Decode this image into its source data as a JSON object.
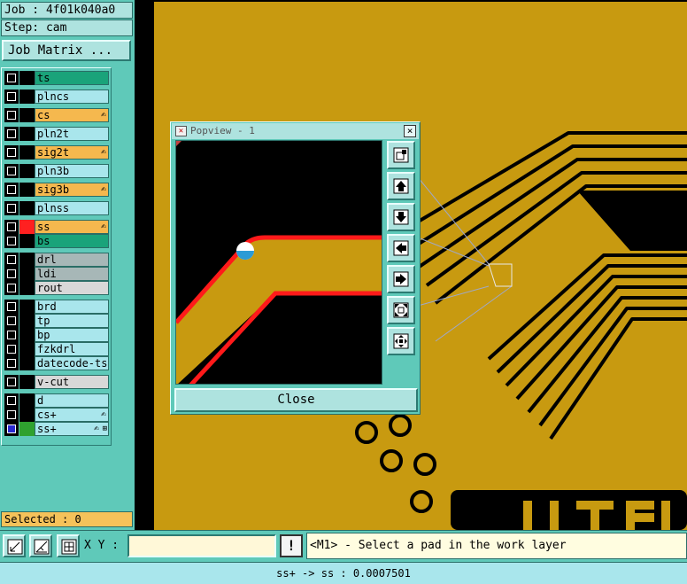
{
  "info": {
    "job": "Job : 4f01k040a0",
    "step": "Step: cam"
  },
  "job_matrix_button": "Job Matrix ...",
  "layers": [
    {
      "name": "ts",
      "color": "#1aa37a",
      "swatch": "#000000",
      "checked": false,
      "flag": ""
    },
    {
      "name": "plncs",
      "color": "#a9e6ec",
      "swatch": "#000000",
      "checked": false,
      "flag": ""
    },
    {
      "name": "cs",
      "color": "#f5b84e",
      "swatch": "#000000",
      "checked": false,
      "flag": "✍"
    },
    {
      "name": "pln2t",
      "color": "#a9e6ec",
      "swatch": "#000000",
      "checked": false,
      "flag": ""
    },
    {
      "name": "sig2t",
      "color": "#f5b84e",
      "swatch": "#000000",
      "checked": false,
      "flag": "✍"
    },
    {
      "name": "pln3b",
      "color": "#a9e6ec",
      "swatch": "#000000",
      "checked": false,
      "flag": ""
    },
    {
      "name": "sig3b",
      "color": "#f5b84e",
      "swatch": "#000000",
      "checked": false,
      "flag": "✍"
    },
    {
      "name": "plnss",
      "color": "#a9e6ec",
      "swatch": "#000000",
      "checked": false,
      "flag": ""
    },
    {
      "name": "ss",
      "color": "#f5b84e",
      "swatch": "#ff2020",
      "checked": false,
      "flag": "✍"
    },
    {
      "name": "bs",
      "color": "#1aa37a",
      "swatch": "#000000",
      "checked": false,
      "flag": ""
    },
    {
      "name": "drl",
      "color": "#a7b7b7",
      "swatch": "#000000",
      "checked": false,
      "flag": ""
    },
    {
      "name": "ldi",
      "color": "#a7b7b7",
      "swatch": "#000000",
      "checked": false,
      "flag": ""
    },
    {
      "name": "rout",
      "color": "#d8d8d8",
      "swatch": "#000000",
      "checked": false,
      "flag": ""
    },
    {
      "name": "brd",
      "color": "#a9e6ec",
      "swatch": "#000000",
      "checked": false,
      "flag": ""
    },
    {
      "name": "tp",
      "color": "#a9e6ec",
      "swatch": "#000000",
      "checked": false,
      "flag": ""
    },
    {
      "name": "bp",
      "color": "#a9e6ec",
      "swatch": "#000000",
      "checked": false,
      "flag": ""
    },
    {
      "name": "fzkdrl",
      "color": "#a9e6ec",
      "swatch": "#000000",
      "checked": false,
      "flag": ""
    },
    {
      "name": "datecode-ts",
      "color": "#a9e6ec",
      "swatch": "#000000",
      "checked": false,
      "flag": ""
    },
    {
      "name": "v-cut",
      "color": "#d8d8d8",
      "swatch": "#000000",
      "checked": false,
      "flag": ""
    },
    {
      "name": "d",
      "color": "#a9e6ec",
      "swatch": "#000000",
      "checked": false,
      "flag": ""
    },
    {
      "name": "cs+",
      "color": "#a9e6ec",
      "swatch": "#000000",
      "checked": false,
      "flag": "✍"
    },
    {
      "name": "ss+",
      "color": "#a9e6ec",
      "swatch": "#2fa12f",
      "checked": true,
      "flag": "✍",
      "grid": "⊞"
    }
  ],
  "selected": "Selected : 0",
  "popview": {
    "title": "Popview - 1",
    "close_x": "×",
    "close_label": "Close",
    "tools": [
      "zoom-fit-icon",
      "pan-up-icon",
      "pan-down-icon",
      "pan-left-icon",
      "pan-right-icon",
      "zoom-in-icon",
      "zoom-out-icon"
    ]
  },
  "bottom": {
    "xy_label": "X Y :",
    "xy_value": "",
    "alert_label": "!",
    "message": "<M1> - Select a pad in the work layer"
  },
  "status": "ss+ -> ss : 0.0007501",
  "colors": {
    "board": "#c89a10",
    "trace_outline": "#000000",
    "panel": "#5fc9b9",
    "popview_trace": "#ff1a1a"
  }
}
